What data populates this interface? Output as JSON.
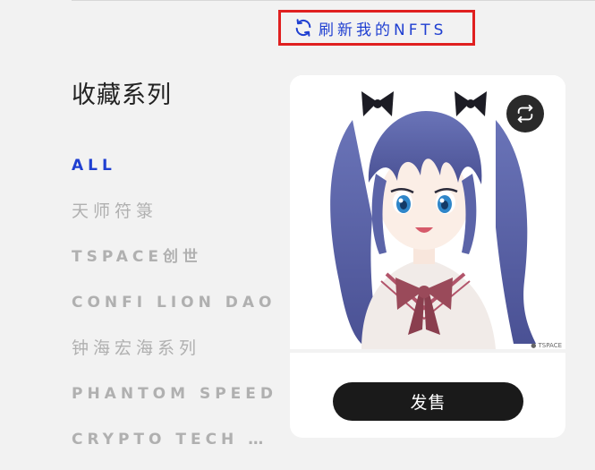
{
  "header": {
    "refresh_label": "刷新我的NFTS",
    "refresh_icon": "refresh-icon",
    "accent_color": "#1f3fd1"
  },
  "sidebar": {
    "title": "收藏系列",
    "items": [
      {
        "label": "ALL",
        "active": true
      },
      {
        "label": "天师符箓",
        "active": false
      },
      {
        "label": "TSPACE创世",
        "active": false
      },
      {
        "label": "CONFI LION DAO",
        "active": false
      },
      {
        "label": "钟海宏海系列",
        "active": false
      },
      {
        "label": "PHANTOM SPEED",
        "active": false
      },
      {
        "label": "CRYPTO TECH NFT",
        "active": false
      }
    ]
  },
  "card": {
    "image_alt": "anime girl with blue twin-tails in sailor uniform",
    "swap_icon": "swap-icon",
    "sell_label": "发售",
    "watermark": "TSPACE"
  }
}
